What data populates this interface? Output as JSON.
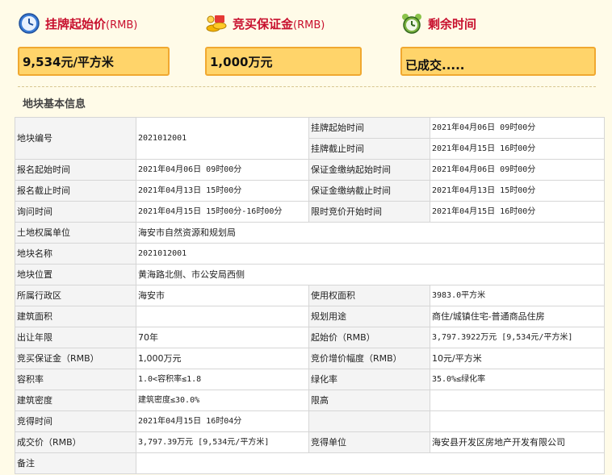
{
  "summary": {
    "start_price": {
      "label": "挂牌起始价",
      "unit_label": "(RMB)",
      "value": "9,534元/平方米",
      "icon": "clock-icon"
    },
    "deposit": {
      "label": "竞买保证金",
      "unit_label": "(RMB)",
      "value": "1,000万元",
      "icon": "money-icon"
    },
    "remaining": {
      "label": "剩余时间",
      "value": "已成交.....",
      "icon": "alarm-clock-icon"
    }
  },
  "section_title": "地块基本信息",
  "rows": {
    "r1": {
      "k1": "地块编号",
      "v1": "2021012001",
      "k2": "挂牌起始时间",
      "v2": "2021年04月06日 09时00分"
    },
    "r2": {
      "k2": "挂牌截止时间",
      "v2": "2021年04月15日 16时00分"
    },
    "r3": {
      "k1": "报名起始时间",
      "v1": "2021年04月06日 09时00分",
      "k2": "保证金缴纳起始时间",
      "v2": "2021年04月06日 09时00分"
    },
    "r4": {
      "k1": "报名截止时间",
      "v1": "2021年04月13日 15时00分",
      "k2": "保证金缴纳截止时间",
      "v2": "2021年04月13日 15时00分"
    },
    "r5": {
      "k1": "询问时间",
      "v1": "2021年04月15日 15时00分-16时00分",
      "k2": "限时竞价开始时间",
      "v2": "2021年04月15日 16时00分"
    },
    "r6": {
      "k1": "土地权属单位",
      "v1": "海安市自然资源和规划局"
    },
    "r7": {
      "k1": "地块名称",
      "v1": "2021012001"
    },
    "r8": {
      "k1": "地块位置",
      "v1": "黄海路北侧、市公安局西侧"
    },
    "r9": {
      "k1": "所属行政区",
      "v1": "海安市",
      "k2": "使用权面积",
      "v2": "3983.0平方米"
    },
    "r10": {
      "k1": "建筑面积",
      "v1": "",
      "k2": "规划用途",
      "v2": "商住/城镇住宅-普通商品住房"
    },
    "r11": {
      "k1": "出让年限",
      "v1": "70年",
      "k2": "起始价（RMB）",
      "v2": "3,797.3922万元 [9,534元/平方米]"
    },
    "r12": {
      "k1": "竞买保证金（RMB）",
      "v1": "1,000万元",
      "k2": "竞价增价幅度（RMB）",
      "v2": "10元/平方米"
    },
    "r13": {
      "k1": "容积率",
      "v1": "1.0<容积率≤1.8",
      "k2": "绿化率",
      "v2": "35.0%≤绿化率"
    },
    "r14": {
      "k1": "建筑密度",
      "v1": "建筑密度≤30.0%",
      "k2": "限高",
      "v2": ""
    },
    "r15": {
      "k1": "竞得时间",
      "v1": "2021年04月15日 16时04分",
      "k2": "",
      "v2": ""
    },
    "r16": {
      "k1": "成交价（RMB）",
      "v1": "3,797.39万元 [9,534元/平方米]",
      "k2": "竞得单位",
      "v2": "海安县开发区房地产开发有限公司"
    },
    "r17": {
      "k1": "备注",
      "v1": ""
    }
  }
}
